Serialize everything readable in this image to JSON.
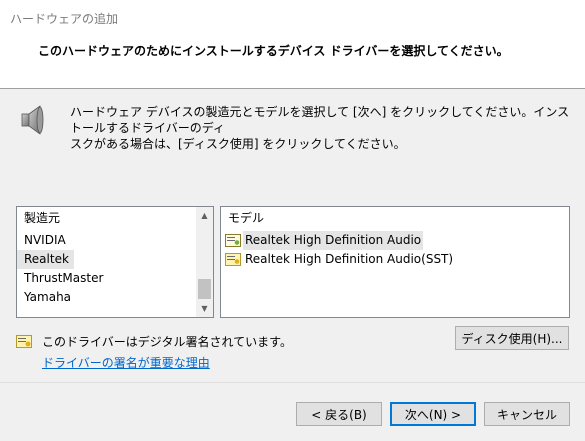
{
  "window": {
    "title": "ハードウェアの追加"
  },
  "header": {
    "instruction": "このハードウェアのためにインストールするデバイス ドライバーを選択してください。"
  },
  "description": {
    "line1": "ハードウェア デバイスの製造元とモデルを選択して [次へ] をクリックしてください。インストールするドライバーのディ",
    "line2": "スクがある場合は、[ディスク使用] をクリックしてください。"
  },
  "manufacturers": {
    "header": "製造元",
    "items": [
      "NVIDIA",
      "Realtek",
      "ThrustMaster",
      "Yamaha"
    ],
    "selected": "Realtek"
  },
  "models": {
    "header": "モデル",
    "items": [
      "Realtek High Definition Audio",
      "Realtek High Definition Audio(SST)"
    ],
    "selected": "Realtek High Definition Audio"
  },
  "signature": {
    "status": "このドライバーはデジタル署名されています。",
    "link": "ドライバーの署名が重要な理由"
  },
  "buttons": {
    "have_disk": "ディスク使用(H)...",
    "back": "< 戻る(B)",
    "next": "次へ(N) >",
    "cancel": "キャンセル"
  },
  "icons": {
    "speaker": "speaker-icon",
    "certificate": "certificate-icon",
    "scroll_up": "scroll-up-icon",
    "scroll_down": "scroll-down-icon"
  },
  "colors": {
    "accent": "#0078d7",
    "link": "#0066cc",
    "selection": "#e5e5e5"
  }
}
